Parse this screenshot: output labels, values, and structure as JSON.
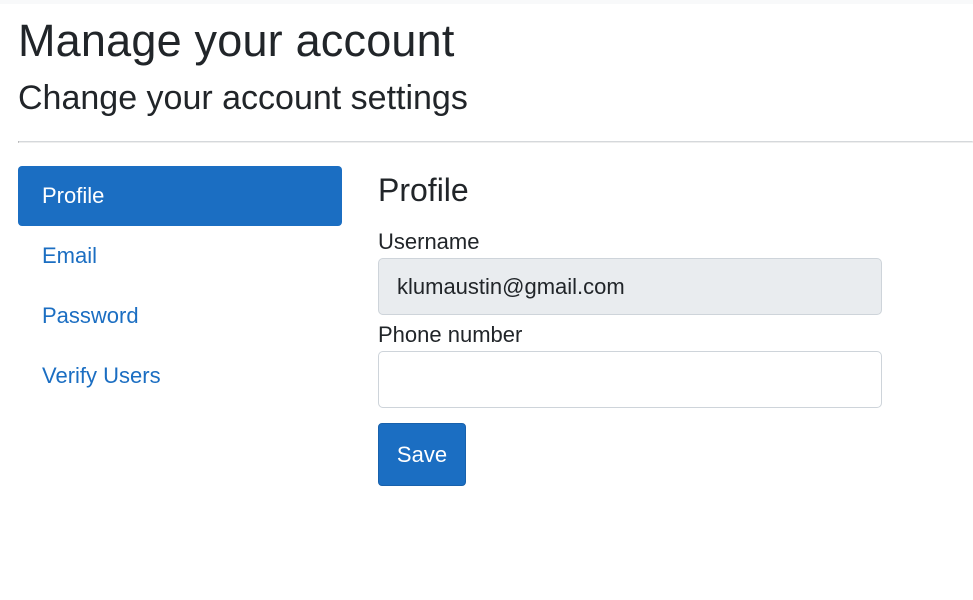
{
  "header": {
    "title": "Manage your account",
    "subtitle": "Change your account settings"
  },
  "nav": {
    "items": [
      {
        "label": "Profile",
        "active": true
      },
      {
        "label": "Email",
        "active": false
      },
      {
        "label": "Password",
        "active": false
      },
      {
        "label": "Verify Users",
        "active": false
      }
    ]
  },
  "profile": {
    "heading": "Profile",
    "username_label": "Username",
    "username_value": "klumaustin@gmail.com",
    "phone_label": "Phone number",
    "phone_value": "",
    "phone_placeholder": "",
    "save_label": "Save"
  },
  "colors": {
    "primary": "#1b6ec2",
    "disabled_input_bg": "#e9ecef",
    "text": "#212529"
  }
}
